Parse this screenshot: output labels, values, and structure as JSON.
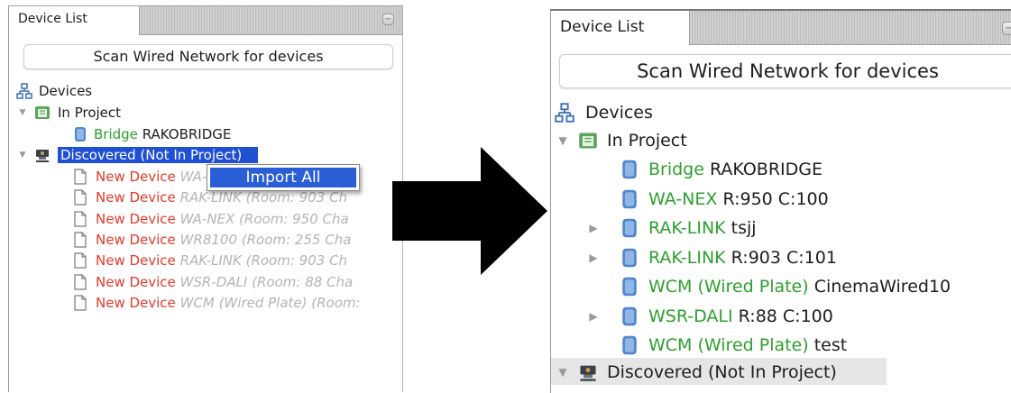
{
  "left_panel": {
    "tab_label": "Device List",
    "scan_label": "Scan Wired Network for devices",
    "root_label": "Devices",
    "in_project_label": "In Project",
    "bridge_kind": "Bridge",
    "bridge_name": "RAKOBRIDGE",
    "discovered_label": "Discovered (Not In Project)",
    "new_devices": [
      {
        "kind": "New Device",
        "detail": "WA-NEX (Room:"
      },
      {
        "kind": "New Device",
        "detail": "RAK-LINK (Room: 903 Ch"
      },
      {
        "kind": "New Device",
        "detail": "WA-NEX (Room: 950 Cha"
      },
      {
        "kind": "New Device",
        "detail": "WR8100 (Room: 255 Cha"
      },
      {
        "kind": "New Device",
        "detail": "RAK-LINK (Room: 903 Ch"
      },
      {
        "kind": "New Device",
        "detail": "WSR-DALI (Room: 88 Cha"
      },
      {
        "kind": "New Device",
        "detail": "WCM (Wired Plate) (Room:"
      }
    ],
    "context_menu_item": "Import All"
  },
  "right_panel": {
    "tab_label": "Device List",
    "scan_label": "Scan Wired Network for devices",
    "root_label": "Devices",
    "in_project_label": "In Project",
    "devices": [
      {
        "kind": "Bridge",
        "name": "RAKOBRIDGE",
        "expandable": false
      },
      {
        "kind": "WA-NEX",
        "name": "R:950 C:100",
        "expandable": false
      },
      {
        "kind": "RAK-LINK",
        "name": "tsjj",
        "expandable": true
      },
      {
        "kind": "RAK-LINK",
        "name": "R:903 C:101",
        "expandable": true
      },
      {
        "kind": "WCM (Wired Plate)",
        "name": "CinemaWired10",
        "expandable": false
      },
      {
        "kind": "WSR-DALI",
        "name": "R:88 C:100",
        "expandable": true
      },
      {
        "kind": "WCM (Wired Plate)",
        "name": "test",
        "expandable": false
      }
    ],
    "discovered_label": "Discovered (Not In Project)"
  },
  "colors": {
    "device_kind_green": "#2e9f2e",
    "new_device_red": "#e5392a",
    "selection_blue": "#1f4fd3",
    "arrow": "#000000"
  },
  "icons": {
    "network": "network-tree-icon",
    "project": "project-folder-icon",
    "discovered": "discovered-network-icon",
    "device": "device-module-icon",
    "new_device": "blank-page-icon",
    "transition": "right-arrow-icon"
  }
}
